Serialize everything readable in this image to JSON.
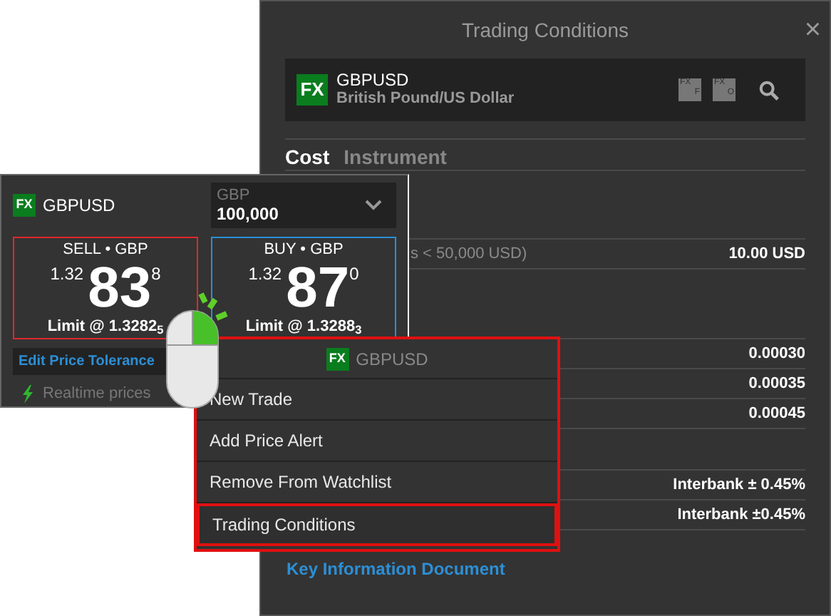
{
  "dialog": {
    "title": "Trading Conditions",
    "close": "×",
    "instrument": {
      "badge": "FX",
      "symbol": "GBPUSD",
      "name": "British Pound/US Dollar",
      "tools": [
        {
          "top": "FX",
          "bottom": "F"
        },
        {
          "top": "FX",
          "bottom": "O"
        }
      ]
    },
    "tabs": [
      {
        "label": "Cost",
        "selected": true
      },
      {
        "label": "Instrument",
        "selected": false
      }
    ],
    "sections": [
      {
        "rows": [
          {
            "label": "s < 50,000 USD)",
            "value": "10.00 USD"
          }
        ]
      },
      {
        "rows": [
          {
            "value": "0.00030"
          },
          {
            "value": "0.00035"
          },
          {
            "value": "0.00045"
          }
        ]
      },
      {
        "rows": [
          {
            "value": "Interbank ± 0.45%"
          },
          {
            "value": "Interbank ±0.45%"
          }
        ]
      }
    ],
    "link": "Key Information Document"
  },
  "ticket": {
    "badge": "FX",
    "symbol": "GBPUSD",
    "amount": {
      "currency": "GBP",
      "value": "100,000"
    },
    "quotes": [
      {
        "kind": "sell",
        "title": "SELL • GBP",
        "prefix": "1.32",
        "big": "83",
        "pip": "8",
        "limit": "Limit @ 1.3282$_{5}$"
      },
      {
        "kind": "buy",
        "title": "BUY • GBP",
        "prefix": "1.32",
        "big": "87",
        "pip": "0",
        "limit": "Limit @ 1.3288$_{3}$"
      }
    ],
    "edit": "Edit Price Tolerance",
    "status": "Realtime prices"
  },
  "menu": {
    "badge": "FX",
    "symbol": "GBPUSD",
    "items": [
      {
        "label": "New Trade",
        "highlighted": false
      },
      {
        "label": "Add Price Alert",
        "highlighted": false
      },
      {
        "label": "Remove From Watchlist",
        "highlighted": false
      },
      {
        "label": "Trading Conditions",
        "highlighted": true
      }
    ]
  }
}
